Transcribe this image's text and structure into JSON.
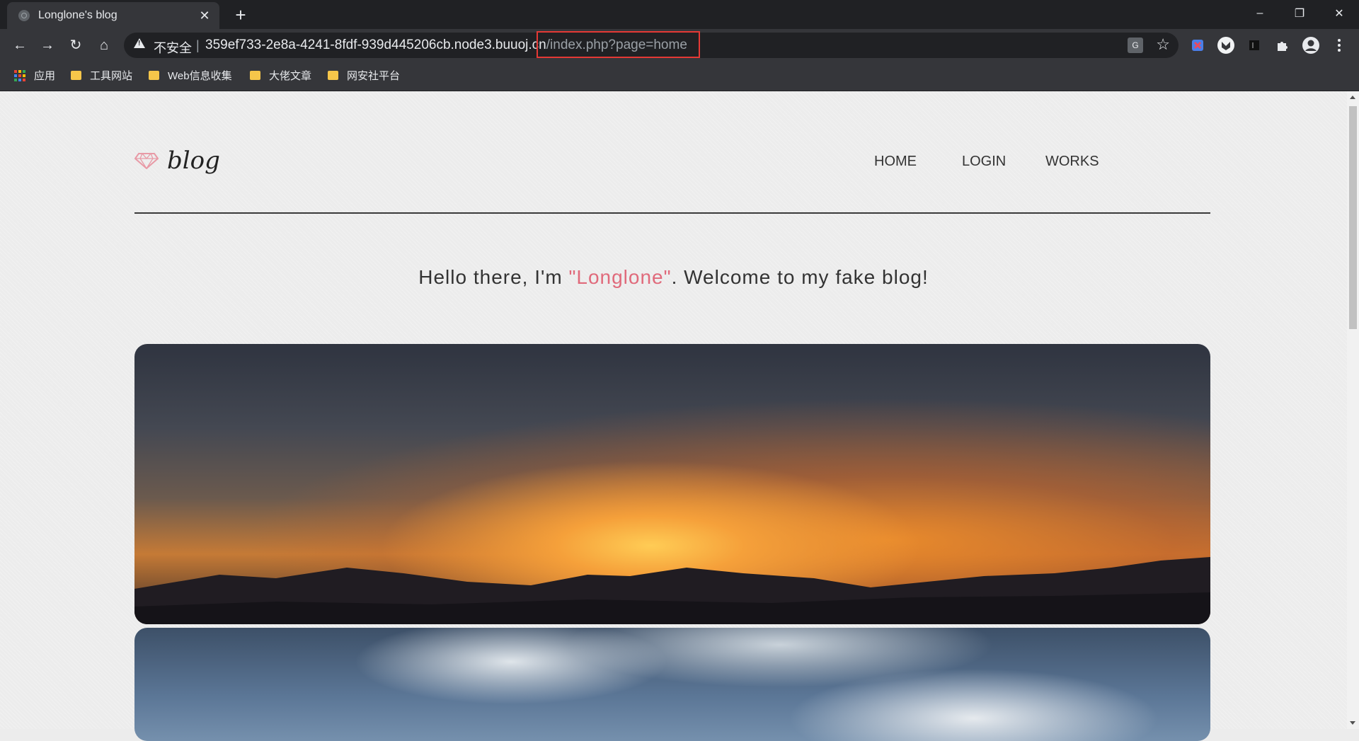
{
  "browser": {
    "tab_title": "Longlone's blog",
    "tab_close": "✕",
    "new_tab": "+",
    "window_controls": {
      "minimize": "–",
      "restore": "❐",
      "close": "✕"
    },
    "nav": {
      "back": "←",
      "forward": "→",
      "reload": "↻",
      "home": "⌂"
    },
    "omnibox": {
      "insecure_label": "不安全",
      "separator": "|",
      "url_host": "359ef733-2e8a-4241-8fdf-939d445206cb.node3.buuoj.cn",
      "url_path": "/index.php?page=home"
    },
    "translate_icon": "G",
    "star_icon": "☆",
    "extensions": [
      "extension-icon",
      "ghost-extension-icon",
      "dark-extension-icon",
      "puzzle-icon",
      "profile-icon",
      "menu-icon"
    ],
    "bookmarks": [
      {
        "label": "应用",
        "type": "apps"
      },
      {
        "label": "工具网站",
        "type": "folder"
      },
      {
        "label": "Web信息收集",
        "type": "folder"
      },
      {
        "label": "大佬文章",
        "type": "folder"
      },
      {
        "label": "网安社平台",
        "type": "folder"
      }
    ]
  },
  "page": {
    "logo_text": "blog",
    "nav": {
      "home": "HOME",
      "login": "LOGIN",
      "works": "WORKS"
    },
    "welcome": {
      "prefix": "Hello there, I'm ",
      "name": "\"Longlone\"",
      "suffix": ". Welcome to my fake blog!"
    },
    "accent_color": "#e06a7b"
  }
}
